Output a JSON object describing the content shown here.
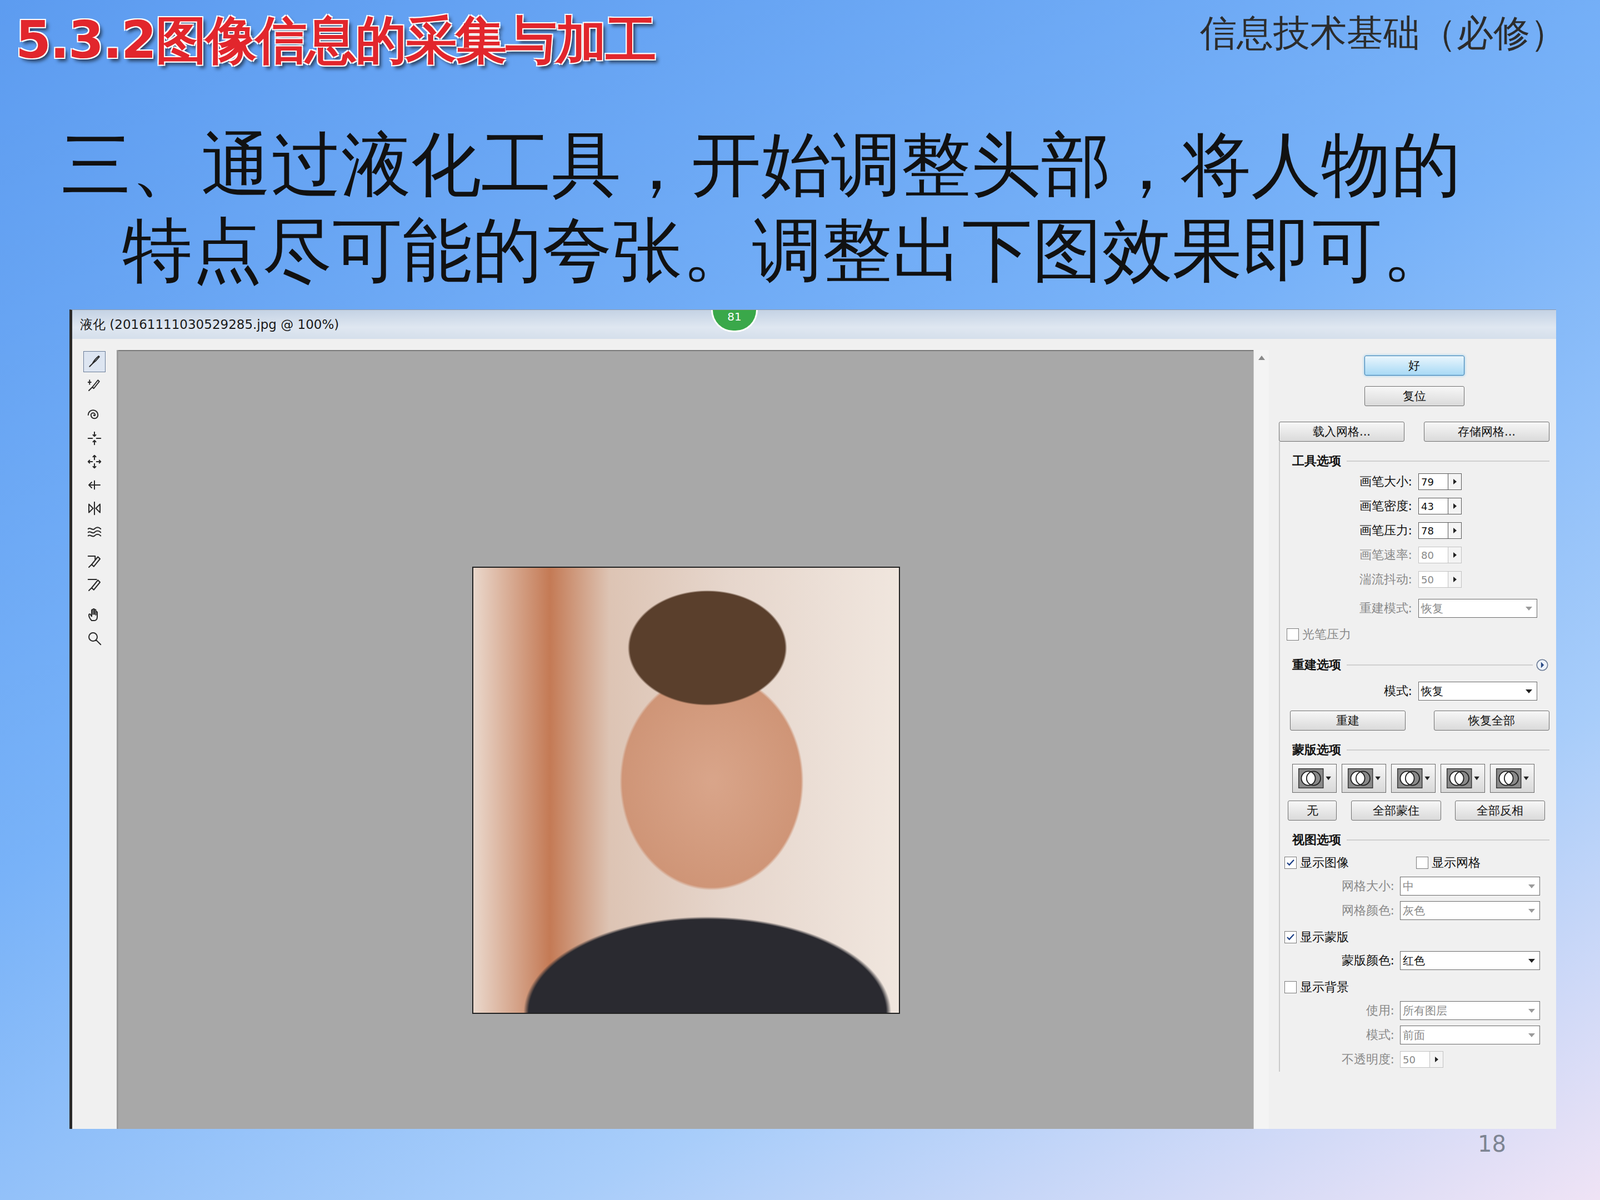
{
  "slide": {
    "section_title": "5.3.2图像信息的采集与加工",
    "course": "信息技术基础（必修）",
    "instruction": [
      "三、通过液化工具，开始调整头部，将人物的",
      "特点尽可能的夸张。调整出下图效果即可。"
    ],
    "page_number": "18"
  },
  "dialog": {
    "title": "液化 (20161111030529285.jpg @ 100%)",
    "badge": "81",
    "tools": [
      {
        "selected": true
      },
      {
        "selected": false
      },
      {
        "selected": false
      },
      {
        "selected": false
      },
      {
        "selected": false
      },
      {
        "selected": false
      },
      {
        "selected": false
      },
      {
        "selected": false
      },
      {
        "selected": false
      },
      {
        "selected": false
      },
      {
        "selected": false
      },
      {
        "selected": false
      }
    ],
    "ok_button": "好",
    "reset_button": "复位",
    "mesh_buttons": [
      "载入网格...",
      "存储网格..."
    ],
    "tool_options": {
      "heading": "工具选项",
      "fields": [
        {
          "label": "画笔大小:",
          "value": "79",
          "kind": "number",
          "disabled": false
        },
        {
          "label": "画笔密度:",
          "value": "43",
          "kind": "number",
          "disabled": false
        },
        {
          "label": "画笔压力:",
          "value": "78",
          "kind": "number",
          "disabled": false
        },
        {
          "label": "画笔速率:",
          "value": "80",
          "kind": "number",
          "disabled": true
        },
        {
          "label": "湍流抖动:",
          "value": "50",
          "kind": "number",
          "disabled": true
        },
        {
          "label": "重建模式:",
          "value": "恢复",
          "kind": "select",
          "disabled": true
        }
      ],
      "stylus": {
        "label": "光笔压力",
        "checked": false,
        "disabled": true
      }
    },
    "reconstruct_options": {
      "heading": "重建选项",
      "mode": {
        "label": "模式:",
        "value": "恢复",
        "disabled": false
      },
      "buttons": [
        "重建",
        "恢复全部"
      ]
    },
    "mask_options": {
      "heading": "蒙版选项",
      "buttons": [
        "无",
        "全部蒙住",
        "全部反相"
      ]
    },
    "view_options": {
      "heading": "视图选项",
      "rows": [
        {
          "kind": "checks",
          "items": [
            {
              "label": "显示图像",
              "checked": true
            },
            {
              "label": "显示网格",
              "checked": false
            }
          ]
        },
        {
          "kind": "select",
          "label": "网格大小:",
          "value": "中",
          "disabled": true
        },
        {
          "kind": "select",
          "label": "网格颜色:",
          "value": "灰色",
          "disabled": true
        },
        {
          "kind": "checks",
          "items": [
            {
              "label": "显示蒙版",
              "checked": true
            }
          ]
        },
        {
          "kind": "select",
          "label": "蒙版颜色:",
          "value": "红色",
          "disabled": false
        },
        {
          "kind": "checks",
          "items": [
            {
              "label": "显示背景",
              "checked": false
            }
          ]
        },
        {
          "kind": "select",
          "label": "使用:",
          "value": "所有图层",
          "disabled": true
        },
        {
          "kind": "select",
          "label": "模式:",
          "value": "前面",
          "disabled": true
        },
        {
          "kind": "number",
          "label": "不透明度:",
          "value": "50",
          "disabled": true
        }
      ]
    }
  }
}
